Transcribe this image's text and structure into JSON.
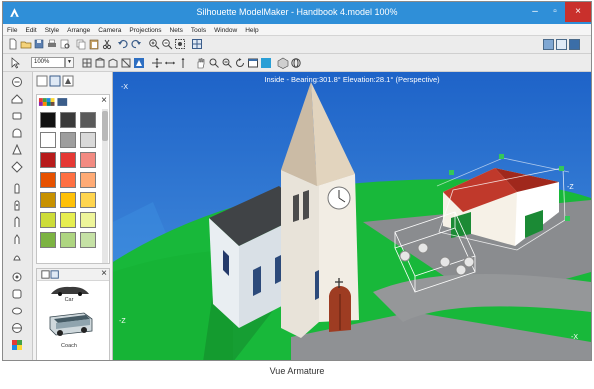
{
  "window": {
    "title": "Silhouette ModelMaker - Handbook 4.model 100%"
  },
  "menu": [
    "File",
    "Edit",
    "Style",
    "Arrange",
    "Camera",
    "Projections",
    "Nets",
    "Tools",
    "Window",
    "Help"
  ],
  "toolbar": {
    "zoom_value": "100%"
  },
  "viewport": {
    "camera_status": "Inside - Bearing:301.8° Elevation:28.1° (Perspective)",
    "axis_labels": {
      "top_left": "-X",
      "left_lower": "-Z",
      "right_upper": "-Z",
      "right_lower": "-X"
    }
  },
  "palette": {
    "colors": [
      "#111111",
      "#3a3a3a",
      "#5a5a5a",
      "#ffffff",
      "#9e9e9e",
      "#d9d9d9",
      "#b71c1c",
      "#e53935",
      "#f28b82",
      "#e65100",
      "#ff7043",
      "#ffab76",
      "#c79100",
      "#ffc107",
      "#ffd54f",
      "#cddc39",
      "#e6ee50",
      "#eef59a",
      "#7cb342",
      "#aed581",
      "#c5e1a5"
    ]
  },
  "models": [
    {
      "label": "Car"
    },
    {
      "label": "Coach"
    }
  ],
  "caption": "Vue Armature"
}
